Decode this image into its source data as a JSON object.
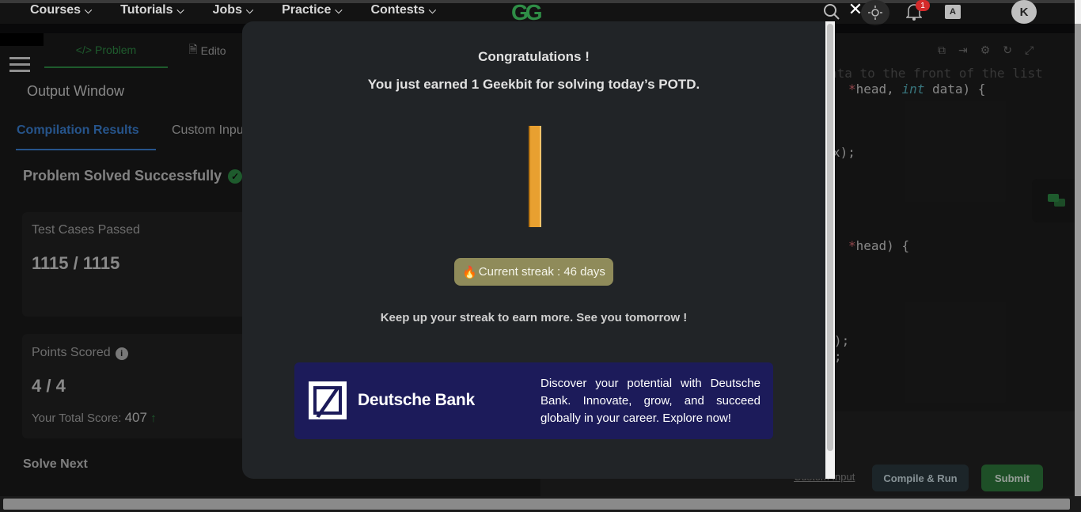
{
  "nav": {
    "items": [
      "Courses",
      "Tutorials",
      "Jobs",
      "Practice",
      "Contests"
    ],
    "logo": "GG"
  },
  "header": {
    "notifications_count": "1",
    "avatar_initial": "K"
  },
  "problem_tabs": {
    "problem": "Problem",
    "editorial": "Edito"
  },
  "output": {
    "title": "Output Window",
    "tabs": {
      "compilation": "Compilation Results",
      "custom": "Custom Inpu"
    },
    "status": "Problem Solved Successfully",
    "test_cases_label": "Test Cases Passed",
    "test_cases_value": "1115 / 1115",
    "points_label": "Points Scored",
    "points_value": "4 / 4",
    "total_score_label": "Your Total Score:",
    "total_score_value": "407",
    "solve_next": "Solve Next"
  },
  "code_lines": [
    {
      "text": "ata to the front of the list"
    },
    {
      "text": "*head, int data) {"
    },
    {
      "text": "x);"
    },
    {
      "text": "*head) {"
    },
    {
      "text": ");"
    },
    {
      "text": ";"
    }
  ],
  "editor_actions": {
    "custom_input": "Custom Input",
    "compile": "Compile & Run",
    "submit": "Submit"
  },
  "modal": {
    "title": "Congratulations !",
    "subtitle": "You just earned 1 Geekbit for solving today’s POTD.",
    "streak": "Current streak : 46 days",
    "keep": "Keep up your streak to earn more. See you tomorrow !",
    "ad": {
      "brand": "Deutsche Bank",
      "text": "Discover your potential with Deutsche Bank. Innovate, grow, and succeed globally in your career. Explore now!"
    }
  },
  "colors": {
    "accent_green": "#2f8d46",
    "link_blue": "#3b82d6",
    "streak_bg": "#8f8b5a",
    "ad_bg": "#1c1b5a"
  }
}
